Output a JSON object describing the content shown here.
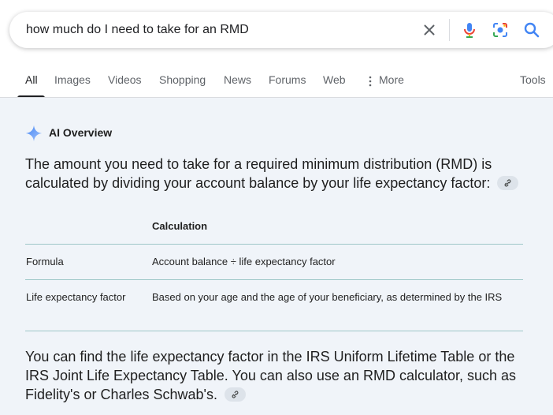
{
  "search": {
    "query": "how much do I need to take for an RMD"
  },
  "tabs": [
    {
      "label": "All"
    },
    {
      "label": "Images"
    },
    {
      "label": "Videos"
    },
    {
      "label": "Shopping"
    },
    {
      "label": "News"
    },
    {
      "label": "Forums"
    },
    {
      "label": "Web"
    },
    {
      "label": "More"
    }
  ],
  "tools_label": "Tools",
  "ai_overview": {
    "title": "AI Overview",
    "intro": "The amount you need to take for a required minimum distribution (RMD) is calculated by dividing your account balance by your life expectancy factor:",
    "table": {
      "header": "Calculation",
      "rows": [
        {
          "label": "Formula",
          "value": "Account balance ÷ life expectancy factor"
        },
        {
          "label": "Life expectancy factor",
          "value": "Based on your age and the age of your beneficiary, as determined by the IRS"
        }
      ]
    },
    "followup": "You can find the life expectancy factor in the IRS Uniform Lifetime Table or the IRS Joint Life Expectancy Table. You can also use an RMD calculator, such as Fidelity's or Charles Schwab's."
  },
  "icons": {
    "clear": "close-icon",
    "mic": "microphone-icon",
    "lens": "camera-lens-icon",
    "search": "search-icon",
    "spark": "sparkle-icon",
    "link": "link-icon",
    "more": "vertical-dots-icon"
  },
  "colors": {
    "blue": "#4285f4",
    "red": "#ea4335",
    "yellow": "#fbbc05",
    "green": "#34a853",
    "panel_bg": "#f0f4f9",
    "table_rule": "#9ec7c8"
  }
}
